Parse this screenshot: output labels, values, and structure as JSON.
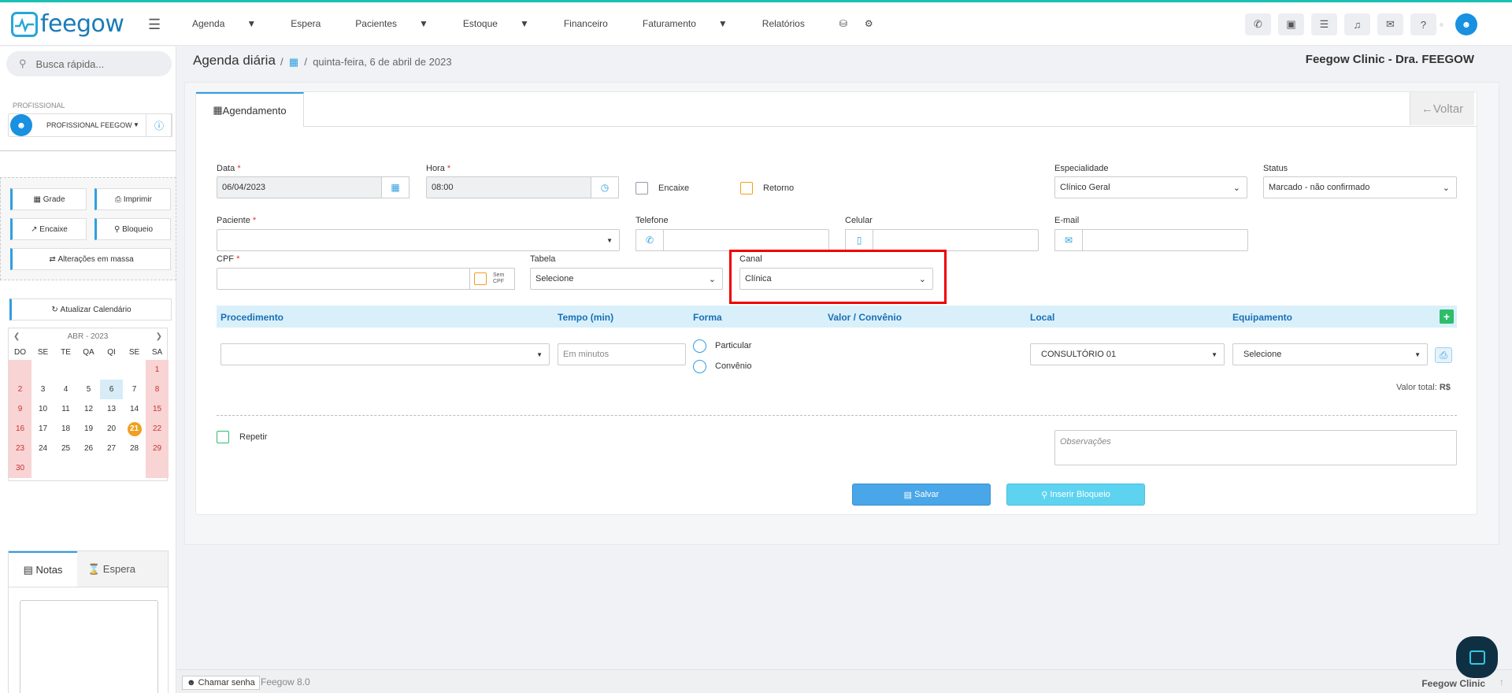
{
  "app": {
    "logo": "feegow",
    "version": "Feegow 8.0",
    "footer_clinic": "Feegow Clinic"
  },
  "nav": {
    "items": [
      {
        "label": "Agenda",
        "caret": true
      },
      {
        "label": "Espera",
        "caret": false
      },
      {
        "label": "Pacientes",
        "caret": true
      },
      {
        "label": "Estoque",
        "caret": true
      },
      {
        "label": "Financeiro",
        "caret": false
      },
      {
        "label": "Faturamento",
        "caret": true
      },
      {
        "label": "Relatórios",
        "caret": false
      }
    ]
  },
  "sidebar": {
    "search_placeholder": "Busca rápida...",
    "profissional_label": "PROFISSIONAL",
    "profissional_name": "PROFISSIONAL FEEGOW",
    "btn_grade": "Grade",
    "btn_imprimir": "Imprimir",
    "btn_encaixe": "Encaixe",
    "btn_bloqueio": "Bloqueio",
    "btn_alteracoes": "Alterações em massa",
    "btn_atualizar": "Atualizar Calendário",
    "calendar": {
      "month": "ABR - 2023",
      "days_header": [
        "DO",
        "SE",
        "TE",
        "QA",
        "QI",
        "SE",
        "SA"
      ],
      "weeks": [
        [
          "",
          "",
          "",
          "",
          "",
          "",
          "1"
        ],
        [
          "2",
          "3",
          "4",
          "5",
          "6",
          "7",
          "8"
        ],
        [
          "9",
          "10",
          "11",
          "12",
          "13",
          "14",
          "15"
        ],
        [
          "16",
          "17",
          "18",
          "19",
          "20",
          "21",
          "22"
        ],
        [
          "23",
          "24",
          "25",
          "26",
          "27",
          "28",
          "29"
        ],
        [
          "30",
          "",
          "",
          "",
          "",
          "",
          ""
        ]
      ],
      "today": "6",
      "highlight": "21"
    },
    "tab_notas": "Notas",
    "tab_espera": "Espera"
  },
  "header": {
    "title": "Agenda diária",
    "date": "quinta-feira, 6 de abril de 2023",
    "clinic": "Feegow Clinic - Dra. FEEGOW"
  },
  "form": {
    "tab": "Agendamento",
    "voltar": "Voltar",
    "data_label": "Data",
    "data_value": "06/04/2023",
    "hora_label": "Hora",
    "hora_value": "08:00",
    "encaixe": "Encaixe",
    "retorno": "Retorno",
    "especialidade_label": "Especialidade",
    "especialidade_value": "Clínico Geral",
    "status_label": "Status",
    "status_value": "Marcado - não confirmado",
    "paciente_label": "Paciente",
    "telefone_label": "Telefone",
    "celular_label": "Celular",
    "email_label": "E-mail",
    "cpf_label": "CPF",
    "sem_cpf": "Sem CPF",
    "tabela_label": "Tabela",
    "tabela_value": "Selecione",
    "canal_label": "Canal",
    "canal_value": "Clínica",
    "proc_headers": {
      "procedimento": "Procedimento",
      "tempo": "Tempo (min)",
      "forma": "Forma",
      "valor": "Valor / Convênio",
      "local": "Local",
      "equipamento": "Equipamento"
    },
    "tempo_placeholder": "Em minutos",
    "particular": "Particular",
    "convenio": "Convênio",
    "local_value": "CONSULTÓRIO 01",
    "equip_value": "Selecione",
    "valor_total": "Valor total:",
    "valor_total_cur": "R$",
    "repetir": "Repetir",
    "observacoes_placeholder": "Observações",
    "btn_salvar": "Salvar",
    "btn_inserir_bloqueio": "Inserir Bloqueio"
  },
  "footer": {
    "chamar_senha": "Chamar senha"
  },
  "colors": {
    "accent": "#2e9fe0",
    "highlight_box": "#e00000",
    "brand": "#1a7bb8"
  }
}
